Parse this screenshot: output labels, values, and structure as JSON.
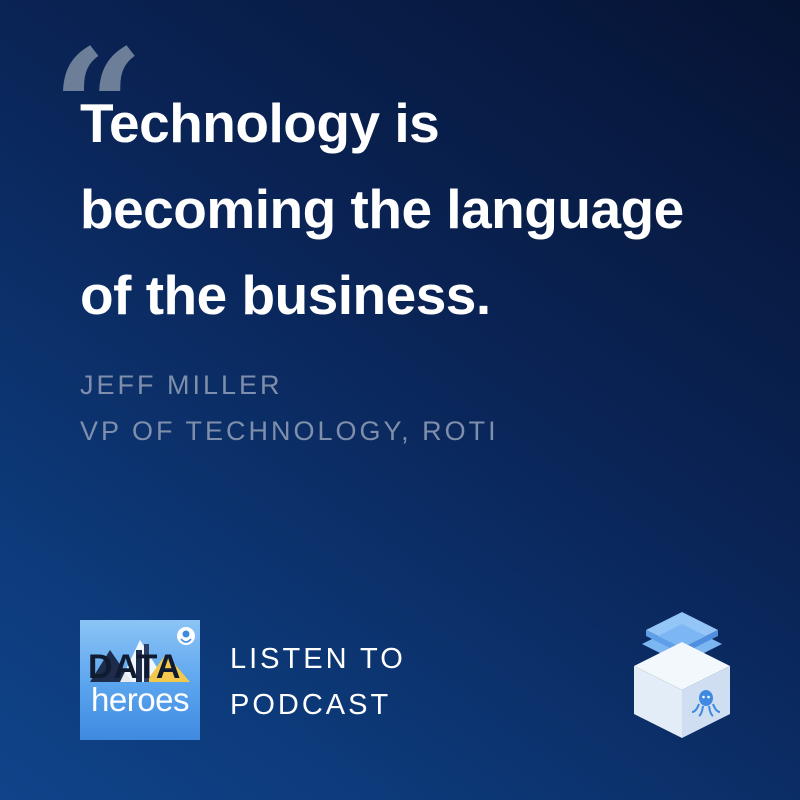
{
  "quote": {
    "mark": "“",
    "lines": [
      "Technology is",
      "becoming the language",
      "of the business."
    ]
  },
  "author": {
    "name": "JEFF MILLER",
    "title": "VP OF TECHNOLOGY, ROTI"
  },
  "podcast": {
    "cover_title": "DATA",
    "cover_subtitle": "heroes",
    "cta_lines": [
      "LISTEN TO",
      "PODCAST"
    ]
  },
  "brand": {
    "logo_icon": "octopus-box-icon",
    "colors": {
      "background_dark": "#061333",
      "background_light": "#0f448a",
      "text_primary": "#ffffff",
      "text_muted": "#7f8fab",
      "accent": "#3f8ae0"
    }
  }
}
